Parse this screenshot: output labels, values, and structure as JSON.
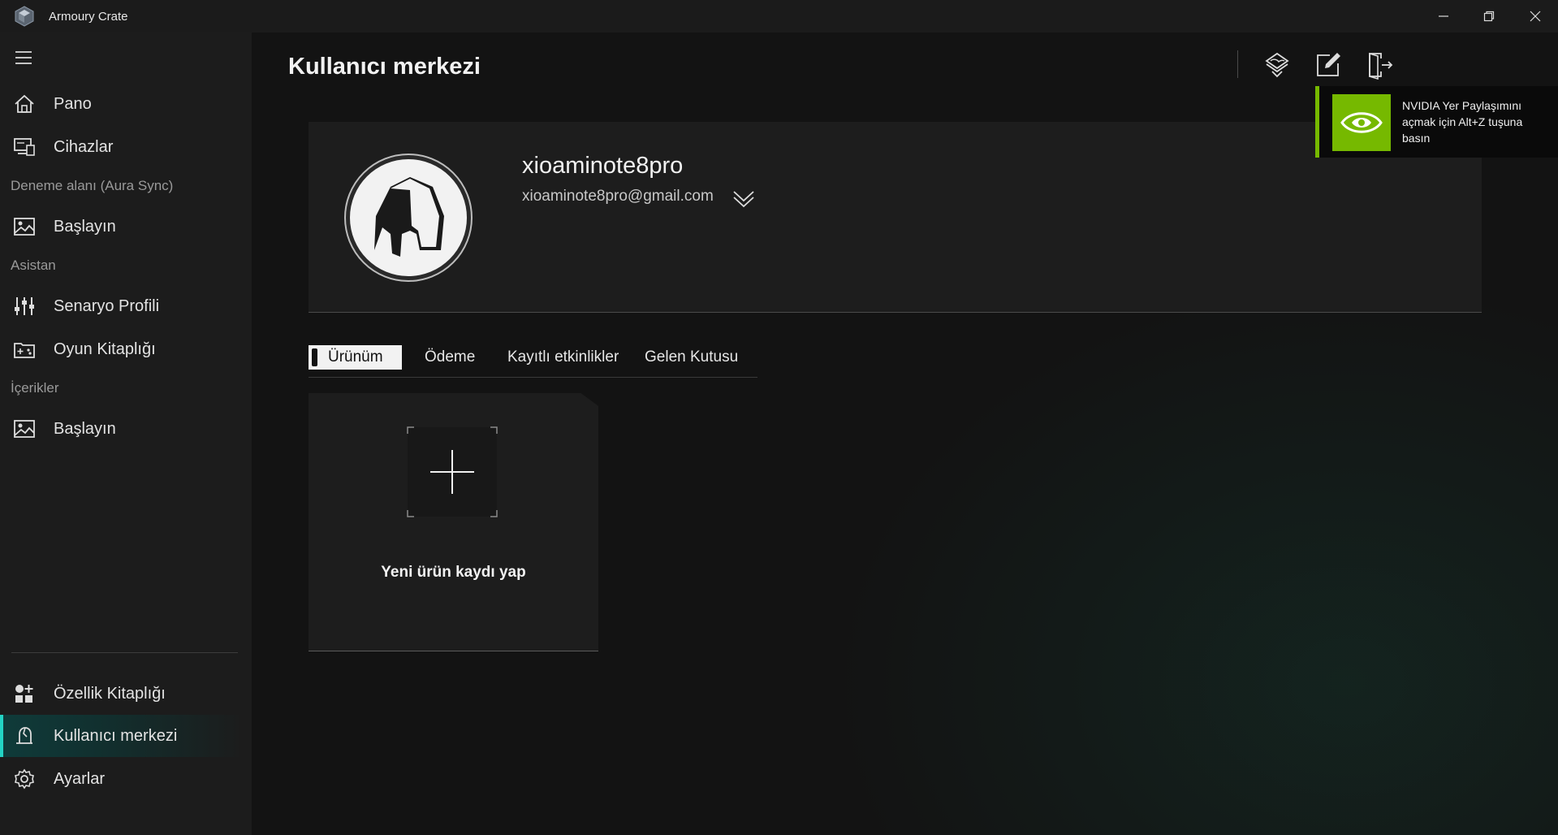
{
  "window": {
    "title": "Armoury Crate",
    "controls": [
      "minimize",
      "restore",
      "close"
    ]
  },
  "sidebar": {
    "items": [
      {
        "label": "Pano",
        "icon": "home-icon"
      },
      {
        "label": "Cihazlar",
        "icon": "devices-icon"
      },
      {
        "label": "Başlayın",
        "icon": "image-icon"
      },
      {
        "label": "Senaryo Profili",
        "icon": "sliders-icon"
      },
      {
        "label": "Oyun Kitaplığı",
        "icon": "game-library-icon"
      },
      {
        "label": "Başlayın",
        "icon": "image-icon"
      },
      {
        "label": "Özellik Kitaplığı",
        "icon": "feature-library-icon"
      },
      {
        "label": "Kullanıcı merkezi",
        "icon": "user-center-icon",
        "active": true
      },
      {
        "label": "Ayarlar",
        "icon": "gear-icon"
      }
    ],
    "sections": [
      "Deneme alanı (Aura Sync)",
      "Asistan",
      "İçerikler"
    ],
    "accent_color": "#23d3c4"
  },
  "page": {
    "title": "Kullanıcı merkezi",
    "header_icons": [
      "rog-member-icon",
      "edit-icon",
      "logout-icon"
    ]
  },
  "profile": {
    "username": "xioaminote8pro",
    "email": "xioaminote8pro@gmail.com"
  },
  "tabs": [
    {
      "label": "Ürünüm",
      "active": true
    },
    {
      "label": "Ödeme"
    },
    {
      "label": "Kayıtlı etkinlikler"
    },
    {
      "label": "Gelen Kutusu"
    }
  ],
  "product_card": {
    "label": "Yeni ürün kaydı yap"
  },
  "toast": {
    "text": "NVIDIA Yer Paylaşımını açmak için Alt+Z tuşuna basın",
    "brand_color": "#76b900"
  }
}
